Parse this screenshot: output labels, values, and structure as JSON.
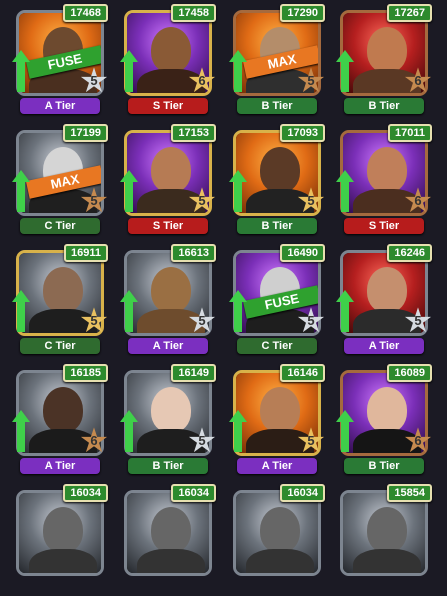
{
  "cards": [
    {
      "score": "17468",
      "stars": "5",
      "tier": "A Tier",
      "tierClass": "A",
      "bg": "bg-orange",
      "frame": "gray",
      "star": "silver",
      "banner": "FUSE",
      "bannerClass": "fuse",
      "head": "#6d4a2f",
      "body": "#4a2f1f",
      "name": "card-1"
    },
    {
      "score": "17458",
      "stars": "6",
      "tier": "S Tier",
      "tierClass": "S",
      "bg": "bg-purple",
      "frame": "gold",
      "star": "gold",
      "banner": "",
      "bannerClass": "",
      "head": "#8a5a36",
      "body": "#3a2217",
      "name": "card-2"
    },
    {
      "score": "17290",
      "stars": "5",
      "tier": "B Tier",
      "tierClass": "B",
      "bg": "bg-orange",
      "frame": "bronze",
      "star": "bronze",
      "banner": "MAX",
      "bannerClass": "max",
      "head": "#b48d6a",
      "body": "#2f2f2f",
      "name": "card-3"
    },
    {
      "score": "17267",
      "stars": "6",
      "tier": "B Tier",
      "tierClass": "B",
      "bg": "bg-red",
      "frame": "bronze",
      "star": "bronze",
      "banner": "",
      "bannerClass": "",
      "head": "#c07a4f",
      "body": "#5a3824",
      "name": "card-4"
    },
    {
      "score": "17199",
      "stars": "5",
      "tier": "C Tier",
      "tierClass": "C",
      "bg": "bg-gray",
      "frame": "gray",
      "star": "bronze",
      "banner": "MAX",
      "bannerClass": "max",
      "head": "#d5d5d5",
      "body": "#1f1f1f",
      "name": "card-5"
    },
    {
      "score": "17153",
      "stars": "5",
      "tier": "S Tier",
      "tierClass": "S",
      "bg": "bg-purple",
      "frame": "gold",
      "star": "gold",
      "banner": "",
      "bannerClass": "",
      "head": "#b67b54",
      "body": "#3b2b1e",
      "name": "card-6"
    },
    {
      "score": "17093",
      "stars": "5",
      "tier": "B Tier",
      "tierClass": "B",
      "bg": "bg-orange",
      "frame": "gold",
      "star": "gold",
      "banner": "",
      "bannerClass": "",
      "head": "#5b3a26",
      "body": "#222",
      "name": "card-7"
    },
    {
      "score": "17011",
      "stars": "6",
      "tier": "S Tier",
      "tierClass": "S",
      "bg": "bg-purple",
      "frame": "bronze",
      "star": "bronze",
      "banner": "",
      "bannerClass": "",
      "head": "#c07f5a",
      "body": "#4b2e1f",
      "name": "card-8"
    },
    {
      "score": "16911",
      "stars": "5",
      "tier": "C Tier",
      "tierClass": "C",
      "bg": "bg-gray",
      "frame": "gold",
      "star": "gold",
      "banner": "",
      "bannerClass": "",
      "head": "#8c6a52",
      "body": "#1e1e1e",
      "name": "card-9"
    },
    {
      "score": "16613",
      "stars": "5",
      "tier": "A Tier",
      "tierClass": "A",
      "bg": "bg-gray",
      "frame": "gray",
      "star": "silver",
      "banner": "",
      "bannerClass": "",
      "head": "#9a6f43",
      "body": "#6e4c2d",
      "name": "card-10"
    },
    {
      "score": "16490",
      "stars": "5",
      "tier": "C Tier",
      "tierClass": "C",
      "bg": "bg-purple",
      "frame": "gray",
      "star": "silver",
      "banner": "FUSE",
      "bannerClass": "fuse",
      "head": "#cfcfcf",
      "body": "#1e1e1e",
      "name": "card-11"
    },
    {
      "score": "16246",
      "stars": "5",
      "tier": "A Tier",
      "tierClass": "A",
      "bg": "bg-red",
      "frame": "gray",
      "star": "silver",
      "banner": "",
      "bannerClass": "",
      "head": "#c58f6e",
      "body": "#2b2b2b",
      "name": "card-12"
    },
    {
      "score": "16185",
      "stars": "6",
      "tier": "A Tier",
      "tierClass": "A",
      "bg": "bg-gray",
      "frame": "gray",
      "star": "bronze",
      "banner": "",
      "bannerClass": "",
      "head": "#4b3326",
      "body": "#1b1b1b",
      "name": "card-13"
    },
    {
      "score": "16149",
      "stars": "5",
      "tier": "B Tier",
      "tierClass": "B",
      "bg": "bg-gray",
      "frame": "gray",
      "star": "silver",
      "banner": "",
      "bannerClass": "",
      "head": "#e6c8b4",
      "body": "#1e1e1e",
      "name": "card-14"
    },
    {
      "score": "16146",
      "stars": "5",
      "tier": "A Tier",
      "tierClass": "A",
      "bg": "bg-orange",
      "frame": "gold",
      "star": "gold",
      "banner": "",
      "bannerClass": "",
      "head": "#b77e56",
      "body": "#2b1d15",
      "name": "card-15"
    },
    {
      "score": "16089",
      "stars": "6",
      "tier": "B Tier",
      "tierClass": "B",
      "bg": "bg-purple",
      "frame": "bronze",
      "star": "bronze",
      "banner": "",
      "bannerClass": "",
      "head": "#e0b79c",
      "body": "#151515",
      "name": "card-16"
    },
    {
      "score": "16034",
      "stars": "",
      "tier": "",
      "tierClass": "",
      "bg": "bg-gray",
      "frame": "gray",
      "star": "silver",
      "banner": "",
      "bannerClass": "",
      "head": "#666",
      "body": "#333",
      "name": "card-17"
    },
    {
      "score": "16034",
      "stars": "",
      "tier": "",
      "tierClass": "",
      "bg": "bg-gray",
      "frame": "gray",
      "star": "silver",
      "banner": "",
      "bannerClass": "",
      "head": "#666",
      "body": "#333",
      "name": "card-18"
    },
    {
      "score": "16034",
      "stars": "",
      "tier": "",
      "tierClass": "",
      "bg": "bg-gray",
      "frame": "gray",
      "star": "silver",
      "banner": "",
      "bannerClass": "",
      "head": "#666",
      "body": "#333",
      "name": "card-19"
    },
    {
      "score": "15854",
      "stars": "",
      "tier": "",
      "tierClass": "",
      "bg": "bg-gray",
      "frame": "gray",
      "star": "silver",
      "banner": "",
      "bannerClass": "",
      "head": "#666",
      "body": "#333",
      "name": "card-20"
    }
  ],
  "icons": {
    "upgrade": "up-arrow-icon",
    "star": "star-icon"
  },
  "colors": {
    "background": "#1b1a24",
    "score": "#2d8a2d",
    "arrow": "#3fd04a"
  }
}
